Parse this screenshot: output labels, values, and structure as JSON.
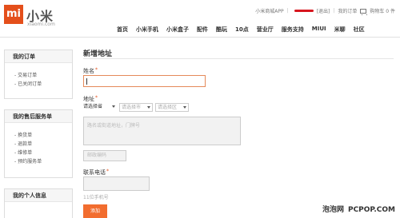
{
  "header": {
    "logo_text": "mi",
    "brand": "小米",
    "site": "xiaomi.com",
    "topbar": {
      "app_link": "小米商城APP",
      "logout": "[退出]",
      "orders": "我的订单",
      "cart": "购物车 0 件"
    },
    "nav": [
      "首页",
      "小米手机",
      "小米盒子",
      "配件",
      "酷玩",
      "10点",
      "营业厅",
      "服务支持",
      "MIUI",
      "米聊",
      "社区"
    ]
  },
  "sidebar": [
    {
      "title": "我的订单",
      "items": [
        "交易订单",
        "已关闭订单"
      ]
    },
    {
      "title": "我的售后服务单",
      "items": [
        "换货单",
        "退款单",
        "维修单",
        "预约服务单"
      ]
    },
    {
      "title": "我的个人信息",
      "items": []
    }
  ],
  "form": {
    "title": "新增地址",
    "name_label": "姓名",
    "region_label": "地址",
    "province_value": "请选择省",
    "city_placeholder": "请选择市",
    "district_placeholder": "请选择区",
    "street_placeholder": "路名或街道地址，门牌号",
    "zip_placeholder": "邮政编码",
    "phone_label": "联系电话",
    "phone_hint": "11位手机号",
    "submit_label": "添加"
  },
  "watermark": {
    "cn": "泡泡网",
    "en": "PCPOP.COM"
  },
  "colors": {
    "accent": "#e44f1b",
    "button": "#f26d2f"
  }
}
